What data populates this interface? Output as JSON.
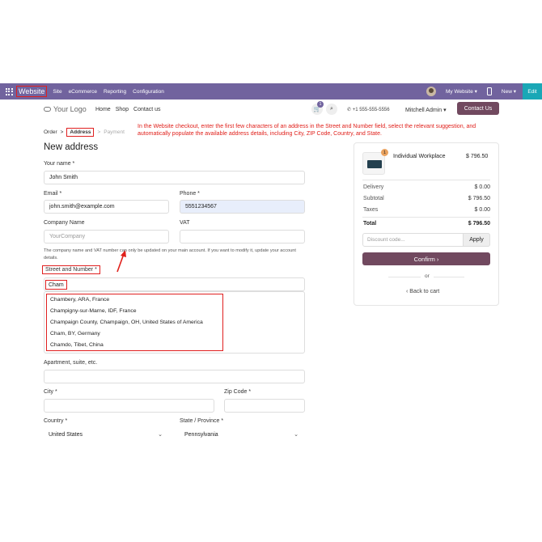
{
  "admin_bar": {
    "brand": "Website",
    "menu": [
      "Site",
      "eCommerce",
      "Reporting",
      "Configuration"
    ],
    "my_website": "My Website ▾",
    "new_label": "New ▾",
    "edit_label": "Edit"
  },
  "site_header": {
    "logo": "Your Logo",
    "nav": [
      "Home",
      "Shop",
      "Contact us"
    ],
    "cart_count": "1",
    "phone": "+1 555-555-5556",
    "user": "Mitchell Admin ▾",
    "contact_button": "Contact Us"
  },
  "annotation": "In the Website checkout, enter the first few characters of an address in the Street and Number field, select the relevant suggestion, and automatically populate the available address details, including City, ZIP Code, Country, and State.",
  "breadcrumb": {
    "order": "Order",
    "sep1": ">",
    "address": "Address",
    "sep2": ">",
    "payment": "Payment"
  },
  "form": {
    "title": "New address",
    "name_label": "Your name *",
    "name_value": "John Smith",
    "email_label": "Email *",
    "email_value": "john.smith@example.com",
    "phone_label": "Phone *",
    "phone_value": "5551234567",
    "company_label": "Company Name",
    "company_placeholder": "YourCompany",
    "vat_label": "VAT",
    "vat_value": "",
    "help_text": "The company name and VAT number can only be updated on your main account. If you want to modify it, update your account details.",
    "street_label": "Street and Number *",
    "street_value": "Cham",
    "suggestions": [
      "Chambery, ARA, France",
      "Champigny-sur-Marne, IDF, France",
      "Champaign County, Champaign, OH, United States of America",
      "Cham, BY, Germany",
      "Chamdo, Tibet, China"
    ],
    "apartment_label": "Apartment, suite, etc.",
    "apartment_value": "",
    "city_label": "City *",
    "city_value": "",
    "zip_label": "Zip Code *",
    "zip_value": "",
    "country_label": "Country *",
    "country_value": "United States",
    "state_label": "State / Province *",
    "state_value": "Pennsylvania"
  },
  "summary": {
    "product_qty": "1",
    "product_name": "Individual Workplace",
    "product_price": "$ 796.50",
    "delivery_label": "Delivery",
    "delivery_value": "$ 0.00",
    "subtotal_label": "Subtotal",
    "subtotal_value": "$ 796.50",
    "taxes_label": "Taxes",
    "taxes_value": "$ 0.00",
    "total_label": "Total",
    "total_value": "$ 796.50",
    "discount_placeholder": "Discount code...",
    "apply_label": "Apply",
    "confirm_label": "Confirm  ›",
    "or_label": "or",
    "back_label": "‹  Back to cart"
  },
  "colors": {
    "admin_bar": "#71639e",
    "primary_button": "#71495f",
    "edit_button": "#1aa7b6",
    "annotation": "#e0201b"
  }
}
